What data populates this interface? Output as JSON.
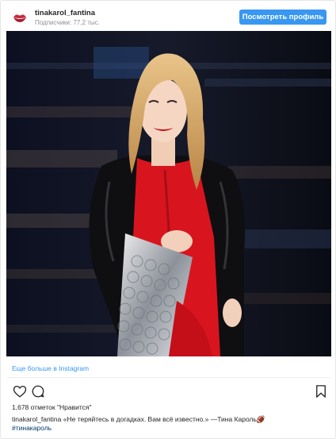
{
  "header": {
    "username": "tinakarol_fantina",
    "followers": "Подписчики: 77,2 тыс.",
    "profile_button": "Посмотреть профиль",
    "avatar_icon": "lips-icon"
  },
  "post": {
    "image_icon": "photo-woman-red-outfit",
    "more_link": "Еще больше в Instagram",
    "likes": "1,678 отметок \"Нравится\"",
    "caption_user": "tinakarol_fantina",
    "caption_text": " «Не теряйтесь в догадках. Вам всё известно.» —Тина Кароль",
    "caption_emoji": "🏈",
    "hashtag": "#тинакароль"
  },
  "actions": {
    "like_icon": "heart-icon",
    "comment_icon": "comment-icon",
    "save_icon": "bookmark-icon"
  },
  "colors": {
    "accent": "#3897f0",
    "hashtag": "#003569",
    "secondary_text": "#8e8e8e"
  }
}
